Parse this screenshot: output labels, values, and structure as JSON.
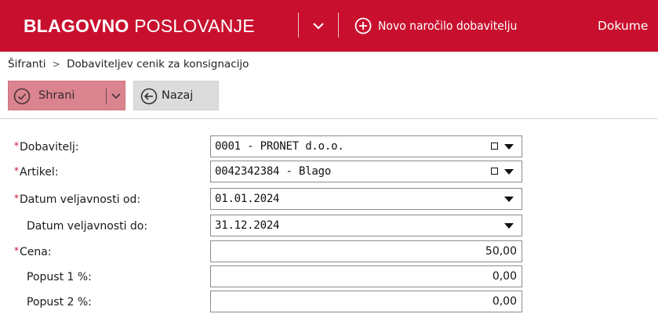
{
  "header": {
    "app_title_bold": "BLAGOVNO",
    "app_title_light": "POSLOVANJE",
    "menu_icon": "chevron-down-icon",
    "new_order_icon": "plus-circle-icon",
    "new_order_label": "Novo naročilo dobavitelju",
    "documents_label": "Dokume",
    "bg_color": "#c8102e"
  },
  "breadcrumb": {
    "root": "Šifranti",
    "separator": ">",
    "current": "Dobaviteljev cenik za konsignacijo"
  },
  "toolbar": {
    "save_label": "Shrani",
    "save_icon": "check-circle-icon",
    "save_bg": "#d9848f",
    "back_label": "Nazaj",
    "back_icon": "arrow-left-circle-icon"
  },
  "form": {
    "required_mark": "*",
    "fields": [
      {
        "label": "Dobavitelj:",
        "value": "0001 - PRONET d.o.o.",
        "required": true
      },
      {
        "label": "Artikel:",
        "value": "0042342384 - Blago",
        "required": true
      },
      {
        "label": "Datum veljavnosti od:",
        "value": "01.01.2024",
        "required": true
      },
      {
        "label": "Datum veljavnosti do:",
        "value": "31.12.2024",
        "required": false
      },
      {
        "label": "Cena:",
        "value": "50,00",
        "required": true
      },
      {
        "label": "Popust 1 %:",
        "value": "0,00",
        "required": false
      },
      {
        "label": "Popust 2 %:",
        "value": "0,00",
        "required": false
      }
    ]
  }
}
